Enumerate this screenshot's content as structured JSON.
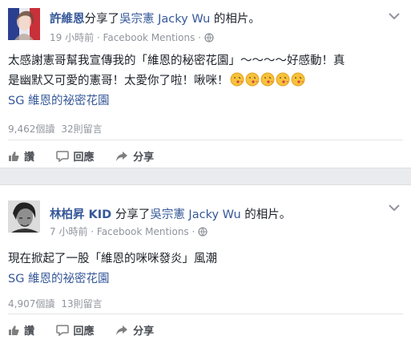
{
  "posts": [
    {
      "author": "許維恩",
      "action": "分享了",
      "page_name": "吳宗憲 Jacky Wu",
      "suffix": " 的相片。",
      "time": "19 小時前",
      "source": "Facebook Mentions",
      "body_line1": "太感謝憲哥幫我宣傳我的「維恩的秘密花園」～～～～好感動！真",
      "body_line2": "是幽默又可愛的憲哥！太愛你了啦！啾咪！",
      "hashtag": "SG 維恩的祕密花園",
      "reads": "9,462個讀",
      "comments": "32則留言",
      "like": "讚",
      "reply": "回應",
      "share": "分享"
    },
    {
      "author": "林柏昇 KID",
      "action": "分享了",
      "page_name": "吳宗憲 Jacky Wu",
      "suffix": " 的相片。",
      "time": "7 小時前",
      "source": "Facebook Mentions",
      "body_line1": "現在掀起了一股「維恩的咪咪發炎」風潮",
      "hashtag": "SG 維恩的祕密花園",
      "reads": "4,907個讀",
      "comments": "13則留言",
      "like": "讚",
      "reply": "回應",
      "share": "分享"
    }
  ],
  "icons": [
    "chevron-down-icon",
    "globe-icon",
    "kiss-emoji",
    "like-icon",
    "comment-icon",
    "share-icon"
  ]
}
